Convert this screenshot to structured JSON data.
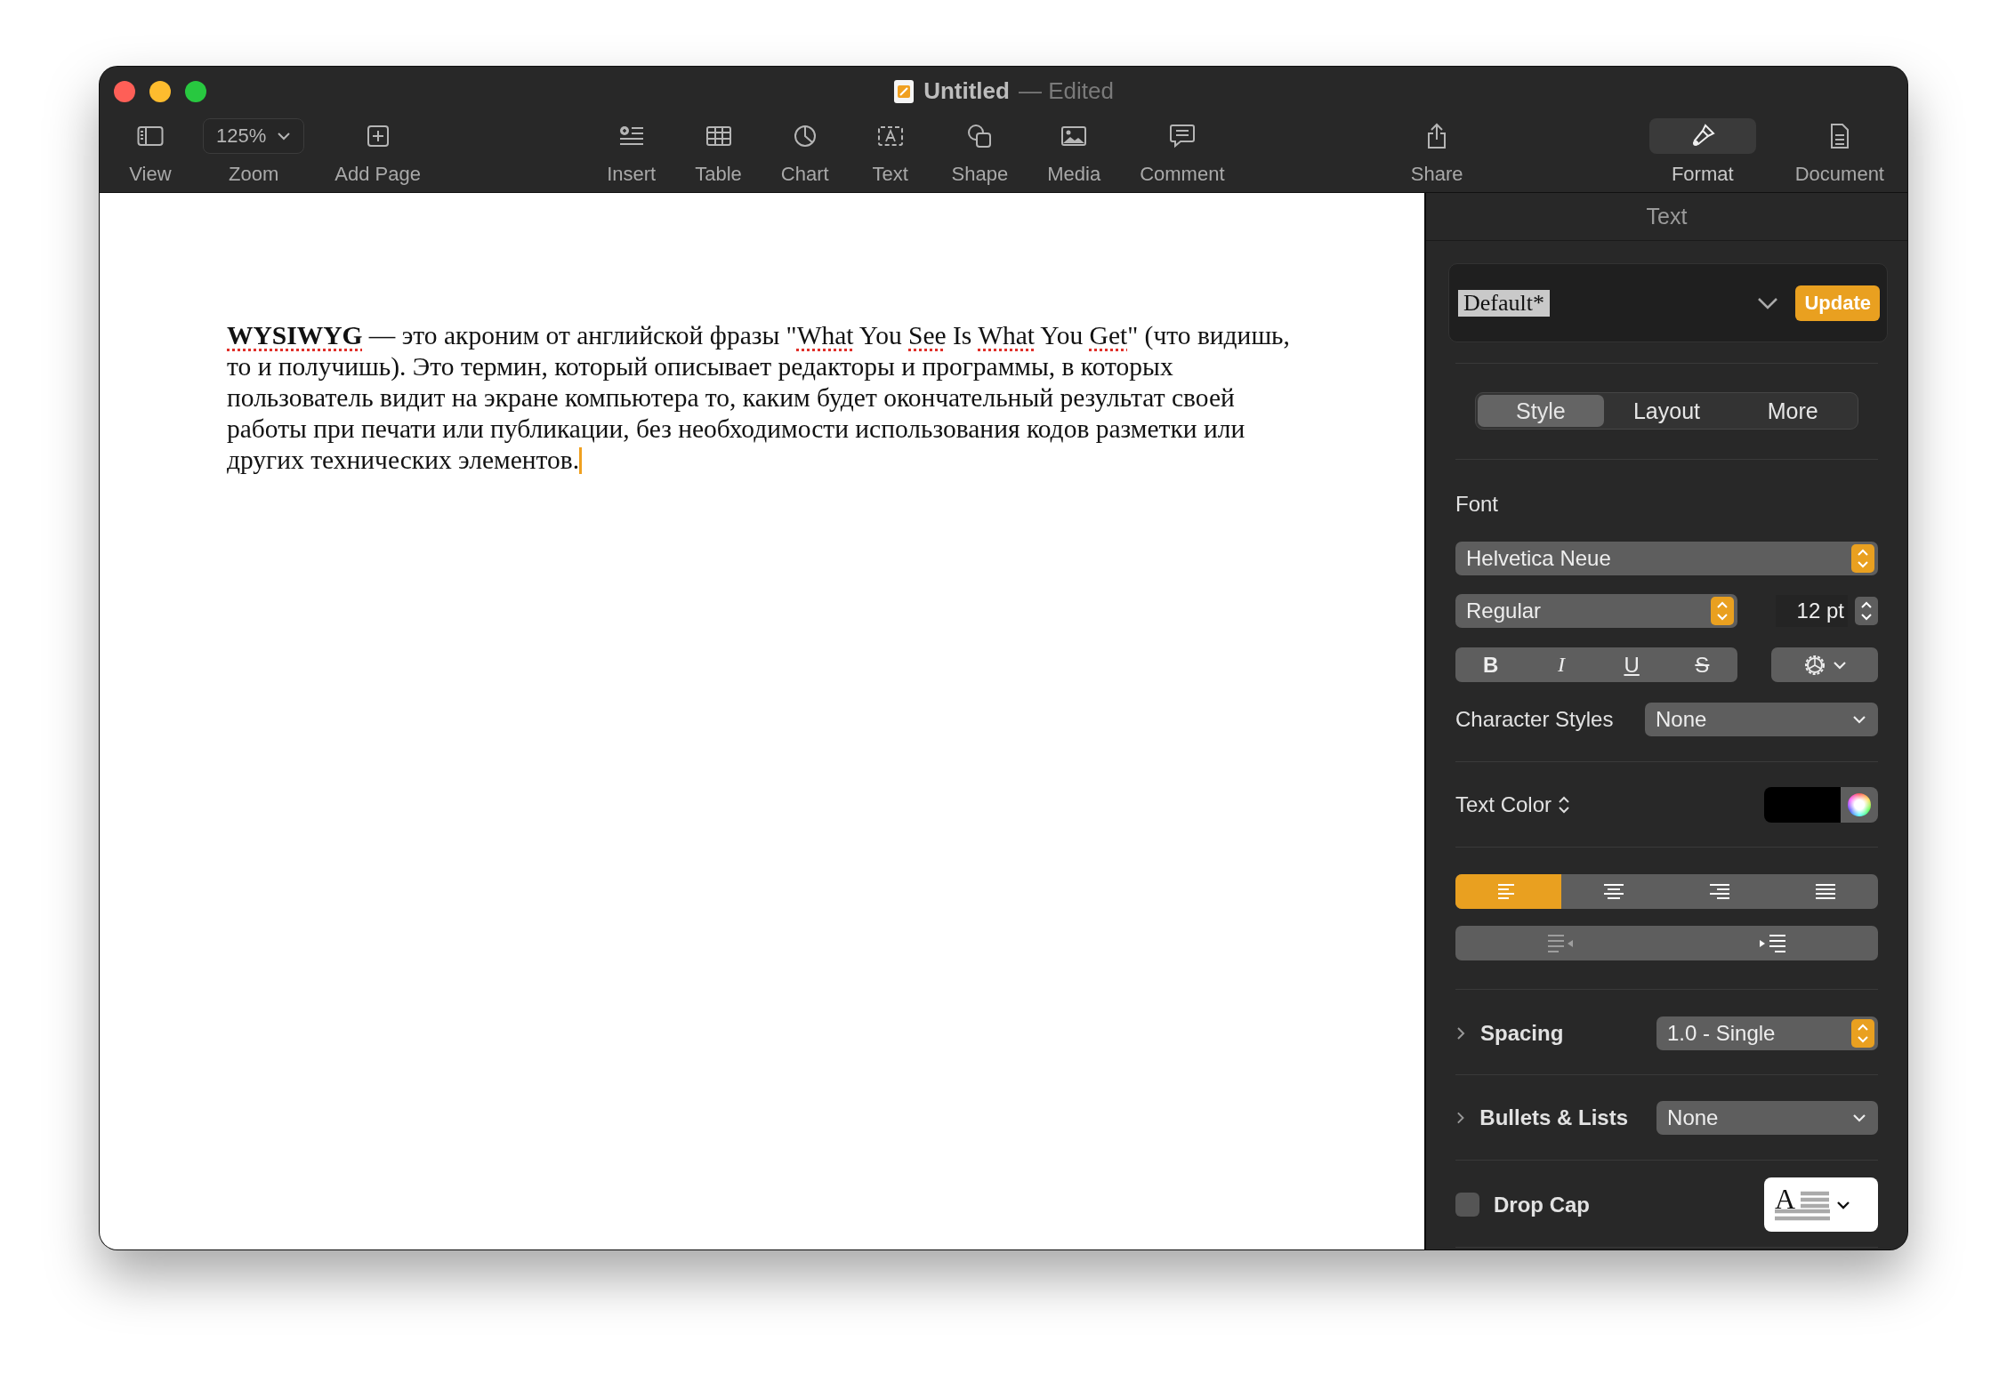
{
  "window": {
    "title": "Untitled",
    "status": "— Edited"
  },
  "toolbar": {
    "left": [
      {
        "kind": "view",
        "label": "View"
      },
      {
        "kind": "zoom",
        "label": "Zoom",
        "value": "125%"
      },
      {
        "kind": "add-page",
        "label": "Add Page"
      }
    ],
    "center": [
      {
        "kind": "insert",
        "label": "Insert"
      },
      {
        "kind": "table",
        "label": "Table"
      },
      {
        "kind": "chart",
        "label": "Chart"
      },
      {
        "kind": "text",
        "label": "Text"
      },
      {
        "kind": "shape",
        "label": "Shape"
      },
      {
        "kind": "media",
        "label": "Media"
      },
      {
        "kind": "comment",
        "label": "Comment"
      }
    ],
    "share": [
      {
        "kind": "share",
        "label": "Share"
      }
    ],
    "right": [
      {
        "kind": "format",
        "label": "Format",
        "selected": true
      },
      {
        "kind": "document",
        "label": "Document",
        "selected": false
      }
    ]
  },
  "document": {
    "cursor": true,
    "paragraph": [
      {
        "text": "WYSIWYG",
        "bold": true,
        "misspelled": true
      },
      {
        "text": " — это акроним от английской фразы \"",
        "bold": false,
        "misspelled": false
      },
      {
        "text": "What",
        "bold": false,
        "misspelled": true
      },
      {
        "text": " You ",
        "bold": false,
        "misspelled": false
      },
      {
        "text": "See",
        "bold": false,
        "misspelled": true
      },
      {
        "text": " Is ",
        "bold": false,
        "misspelled": false
      },
      {
        "text": "What",
        "bold": false,
        "misspelled": true
      },
      {
        "text": " You ",
        "bold": false,
        "misspelled": false
      },
      {
        "text": "Get",
        "bold": false,
        "misspelled": true
      },
      {
        "text": "\" (что видишь, то и получишь). Это термин, который описывает редакторы и программы, в которых пользователь видит на экране компьютера то, каким будет окончательный результат своей работы при печати или публикации, без необходимости использования кодов разметки или других технических элементов.",
        "bold": false,
        "misspelled": false
      }
    ]
  },
  "inspector": {
    "title": "Text",
    "paragraph_style": {
      "name": "Default*",
      "button": "Update"
    },
    "tabs": [
      {
        "label": "Style",
        "selected": true
      },
      {
        "label": "Layout",
        "selected": false
      },
      {
        "label": "More",
        "selected": false
      }
    ],
    "font": {
      "label": "Font",
      "family": "Helvetica Neue",
      "typeface": "Regular",
      "size": "12 pt",
      "styles": [
        {
          "kind": "bold",
          "label": "B",
          "on": false
        },
        {
          "kind": "italic",
          "label": "I",
          "on": false
        },
        {
          "kind": "underline",
          "label": "U",
          "on": false
        },
        {
          "kind": "strike",
          "label": "S",
          "on": false
        }
      ]
    },
    "character_styles": {
      "label": "Character Styles",
      "value": "None"
    },
    "text_color": {
      "label": "Text Color",
      "color": "#000000"
    },
    "alignment": [
      {
        "kind": "left",
        "selected": true
      },
      {
        "kind": "center",
        "selected": false
      },
      {
        "kind": "right",
        "selected": false
      },
      {
        "kind": "justify",
        "selected": false
      }
    ],
    "indent": [
      {
        "kind": "decrease",
        "disabled": true
      },
      {
        "kind": "increase",
        "disabled": false
      }
    ],
    "spacing": {
      "label": "Spacing",
      "expanded": false,
      "value": "1.0 - Single"
    },
    "bullets": {
      "label": "Bullets & Lists",
      "expanded": false,
      "value": "None"
    },
    "drop_cap": {
      "label": "Drop Cap",
      "checked": false,
      "letter": "A"
    }
  }
}
